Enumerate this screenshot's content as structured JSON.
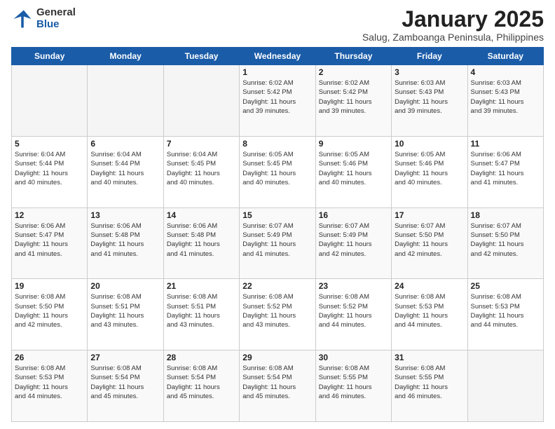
{
  "header": {
    "logo_general": "General",
    "logo_blue": "Blue",
    "title": "January 2025",
    "location": "Salug, Zamboanga Peninsula, Philippines"
  },
  "calendar": {
    "days_of_week": [
      "Sunday",
      "Monday",
      "Tuesday",
      "Wednesday",
      "Thursday",
      "Friday",
      "Saturday"
    ],
    "weeks": [
      [
        {
          "day": "",
          "info": ""
        },
        {
          "day": "",
          "info": ""
        },
        {
          "day": "",
          "info": ""
        },
        {
          "day": "1",
          "info": "Sunrise: 6:02 AM\nSunset: 5:42 PM\nDaylight: 11 hours\nand 39 minutes."
        },
        {
          "day": "2",
          "info": "Sunrise: 6:02 AM\nSunset: 5:42 PM\nDaylight: 11 hours\nand 39 minutes."
        },
        {
          "day": "3",
          "info": "Sunrise: 6:03 AM\nSunset: 5:43 PM\nDaylight: 11 hours\nand 39 minutes."
        },
        {
          "day": "4",
          "info": "Sunrise: 6:03 AM\nSunset: 5:43 PM\nDaylight: 11 hours\nand 39 minutes."
        }
      ],
      [
        {
          "day": "5",
          "info": "Sunrise: 6:04 AM\nSunset: 5:44 PM\nDaylight: 11 hours\nand 40 minutes."
        },
        {
          "day": "6",
          "info": "Sunrise: 6:04 AM\nSunset: 5:44 PM\nDaylight: 11 hours\nand 40 minutes."
        },
        {
          "day": "7",
          "info": "Sunrise: 6:04 AM\nSunset: 5:45 PM\nDaylight: 11 hours\nand 40 minutes."
        },
        {
          "day": "8",
          "info": "Sunrise: 6:05 AM\nSunset: 5:45 PM\nDaylight: 11 hours\nand 40 minutes."
        },
        {
          "day": "9",
          "info": "Sunrise: 6:05 AM\nSunset: 5:46 PM\nDaylight: 11 hours\nand 40 minutes."
        },
        {
          "day": "10",
          "info": "Sunrise: 6:05 AM\nSunset: 5:46 PM\nDaylight: 11 hours\nand 40 minutes."
        },
        {
          "day": "11",
          "info": "Sunrise: 6:06 AM\nSunset: 5:47 PM\nDaylight: 11 hours\nand 41 minutes."
        }
      ],
      [
        {
          "day": "12",
          "info": "Sunrise: 6:06 AM\nSunset: 5:47 PM\nDaylight: 11 hours\nand 41 minutes."
        },
        {
          "day": "13",
          "info": "Sunrise: 6:06 AM\nSunset: 5:48 PM\nDaylight: 11 hours\nand 41 minutes."
        },
        {
          "day": "14",
          "info": "Sunrise: 6:06 AM\nSunset: 5:48 PM\nDaylight: 11 hours\nand 41 minutes."
        },
        {
          "day": "15",
          "info": "Sunrise: 6:07 AM\nSunset: 5:49 PM\nDaylight: 11 hours\nand 41 minutes."
        },
        {
          "day": "16",
          "info": "Sunrise: 6:07 AM\nSunset: 5:49 PM\nDaylight: 11 hours\nand 42 minutes."
        },
        {
          "day": "17",
          "info": "Sunrise: 6:07 AM\nSunset: 5:50 PM\nDaylight: 11 hours\nand 42 minutes."
        },
        {
          "day": "18",
          "info": "Sunrise: 6:07 AM\nSunset: 5:50 PM\nDaylight: 11 hours\nand 42 minutes."
        }
      ],
      [
        {
          "day": "19",
          "info": "Sunrise: 6:08 AM\nSunset: 5:50 PM\nDaylight: 11 hours\nand 42 minutes."
        },
        {
          "day": "20",
          "info": "Sunrise: 6:08 AM\nSunset: 5:51 PM\nDaylight: 11 hours\nand 43 minutes."
        },
        {
          "day": "21",
          "info": "Sunrise: 6:08 AM\nSunset: 5:51 PM\nDaylight: 11 hours\nand 43 minutes."
        },
        {
          "day": "22",
          "info": "Sunrise: 6:08 AM\nSunset: 5:52 PM\nDaylight: 11 hours\nand 43 minutes."
        },
        {
          "day": "23",
          "info": "Sunrise: 6:08 AM\nSunset: 5:52 PM\nDaylight: 11 hours\nand 44 minutes."
        },
        {
          "day": "24",
          "info": "Sunrise: 6:08 AM\nSunset: 5:53 PM\nDaylight: 11 hours\nand 44 minutes."
        },
        {
          "day": "25",
          "info": "Sunrise: 6:08 AM\nSunset: 5:53 PM\nDaylight: 11 hours\nand 44 minutes."
        }
      ],
      [
        {
          "day": "26",
          "info": "Sunrise: 6:08 AM\nSunset: 5:53 PM\nDaylight: 11 hours\nand 44 minutes."
        },
        {
          "day": "27",
          "info": "Sunrise: 6:08 AM\nSunset: 5:54 PM\nDaylight: 11 hours\nand 45 minutes."
        },
        {
          "day": "28",
          "info": "Sunrise: 6:08 AM\nSunset: 5:54 PM\nDaylight: 11 hours\nand 45 minutes."
        },
        {
          "day": "29",
          "info": "Sunrise: 6:08 AM\nSunset: 5:54 PM\nDaylight: 11 hours\nand 45 minutes."
        },
        {
          "day": "30",
          "info": "Sunrise: 6:08 AM\nSunset: 5:55 PM\nDaylight: 11 hours\nand 46 minutes."
        },
        {
          "day": "31",
          "info": "Sunrise: 6:08 AM\nSunset: 5:55 PM\nDaylight: 11 hours\nand 46 minutes."
        },
        {
          "day": "",
          "info": ""
        }
      ]
    ]
  }
}
